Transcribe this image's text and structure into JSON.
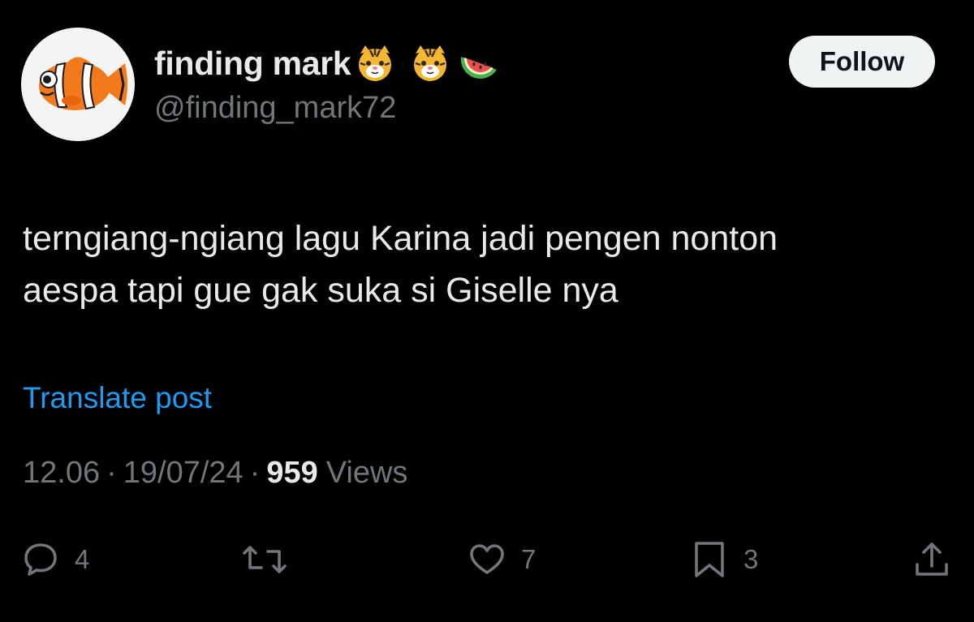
{
  "author": {
    "display_name": "finding mark",
    "name_emojis": [
      "tiger-face",
      "tiger-face",
      "watermelon"
    ],
    "handle": "@finding_mark72",
    "avatar": "clownfish-avatar"
  },
  "follow_label": "Follow",
  "post": {
    "text": "terngiang-ngiang lagu Karina jadi pengen nonton\naespa tapi gue gak suka si Giselle nya",
    "translate_label": "Translate post"
  },
  "meta": {
    "time": "12.06",
    "separator": "·",
    "date": "19/07/24",
    "views_count": "959",
    "views_label": "Views"
  },
  "actions": {
    "reply_count": "4",
    "like_count": "7",
    "bookmark_count": "3"
  },
  "colors": {
    "background": "#000000",
    "text_primary": "#e7e9ea",
    "text_secondary": "#71767b",
    "link": "#1d9bf0",
    "follow_bg": "#eff3f4"
  }
}
